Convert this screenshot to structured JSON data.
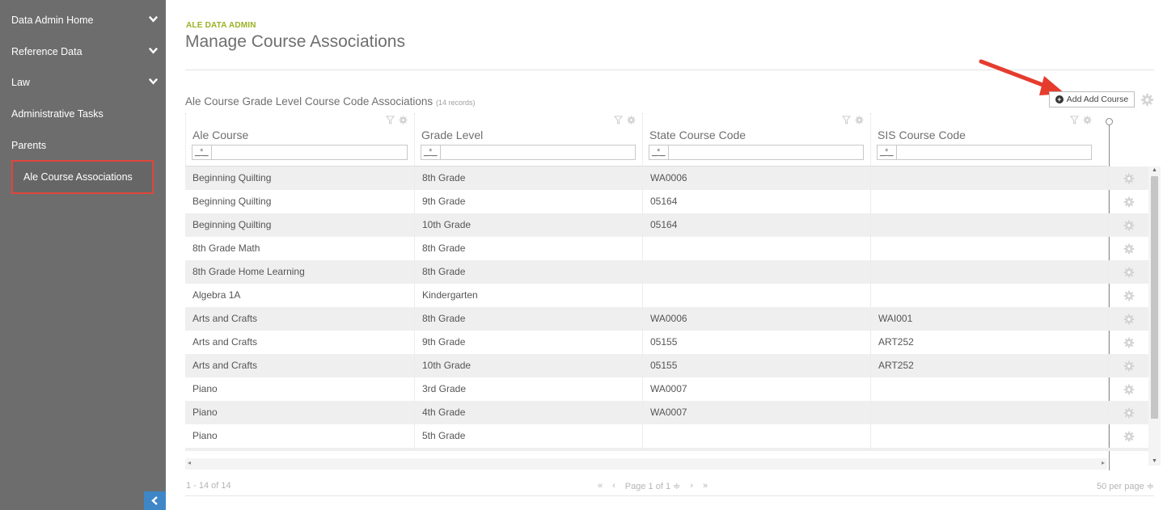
{
  "sidebar": {
    "items": [
      {
        "label": "Data Admin Home",
        "has_chevron": true
      },
      {
        "label": "Reference Data",
        "has_chevron": true
      },
      {
        "label": "Law",
        "has_chevron": true
      },
      {
        "label": "Administrative Tasks",
        "has_chevron": false
      },
      {
        "label": "Parents",
        "has_chevron": false
      },
      {
        "label": "Ale Course Associations",
        "has_chevron": false,
        "active": true
      }
    ],
    "collapse_icon": "chevron-left-icon",
    "collapse_glyph": "‹"
  },
  "header": {
    "eyebrow": "ALE DATA ADMIN",
    "title": "Manage Course Associations"
  },
  "grid": {
    "caption": "Ale Course Grade Level Course Code Associations",
    "record_count": "(14 records)",
    "add_button_label": "Add Add Course",
    "add_button_icon": "plus-circle-icon",
    "columns": [
      {
        "title": "Ale Course",
        "filter": "_*_"
      },
      {
        "title": "Grade Level",
        "filter": "_*_"
      },
      {
        "title": "State Course Code",
        "filter": "_*_"
      },
      {
        "title": "SIS Course Code",
        "filter": "_*_"
      }
    ],
    "rows": [
      [
        "Beginning Quilting",
        "8th Grade",
        "WA0006",
        ""
      ],
      [
        "Beginning Quilting",
        "9th Grade",
        "05164",
        ""
      ],
      [
        "Beginning Quilting",
        "10th Grade",
        "05164",
        ""
      ],
      [
        "8th Grade Math",
        "8th Grade",
        "",
        ""
      ],
      [
        "8th Grade Home Learning",
        "8th Grade",
        "",
        ""
      ],
      [
        "Algebra 1A",
        "Kindergarten",
        "",
        ""
      ],
      [
        "Arts and Crafts",
        "8th Grade",
        "WA0006",
        "WAI001"
      ],
      [
        "Arts and Crafts",
        "9th Grade",
        "05155",
        "ART252"
      ],
      [
        "Arts and Crafts",
        "10th Grade",
        "05155",
        "ART252"
      ],
      [
        "Piano",
        "3rd Grade",
        "WA0007",
        ""
      ],
      [
        "Piano",
        "4th Grade",
        "WA0007",
        ""
      ],
      [
        "Piano",
        "5th Grade",
        "",
        ""
      ]
    ]
  },
  "footer": {
    "range": "1 - 14 of 14",
    "first": "«",
    "prev": "‹",
    "page": "Page 1 of 1 ≑",
    "next": "›",
    "last": "»",
    "per_page": "50 per page ≑"
  },
  "colors": {
    "sidebar_bg": "#6d6d6d",
    "accent_green": "#9ab223",
    "highlight_red": "#e0463c",
    "collapse_blue": "#3f86c7",
    "row_alt": "#efefef"
  }
}
